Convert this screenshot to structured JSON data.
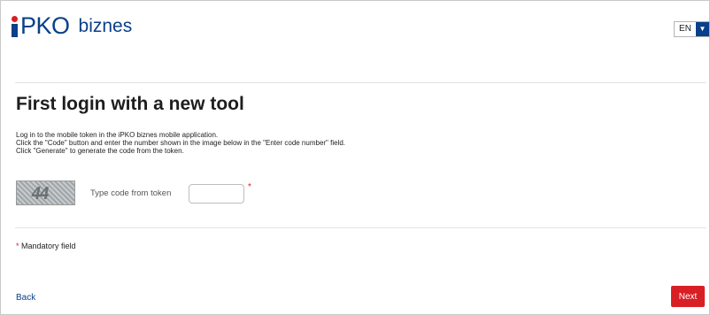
{
  "brand": {
    "logo_text": "PKO",
    "product": "biznes"
  },
  "language": {
    "selected": "EN",
    "arrow": "▼"
  },
  "page": {
    "title": "First login with a new tool",
    "instructions": [
      "Log in to the mobile token in the iPKO biznes mobile application.",
      "Click the \"Code\" button and enter the number shown in the image below in the \"Enter code number\" field.",
      "Click \"Generate\" to generate the code from the token."
    ]
  },
  "captcha": {
    "digits": "44"
  },
  "code_field": {
    "label": "Type code from token",
    "value": "",
    "required_marker": "*"
  },
  "mandatory_note": {
    "marker": "*",
    "text": "Mandatory field"
  },
  "nav": {
    "back_label": "Back",
    "next_label": "Next"
  },
  "colors": {
    "brand_blue": "#0a3f8a",
    "accent_red": "#d81f26"
  }
}
